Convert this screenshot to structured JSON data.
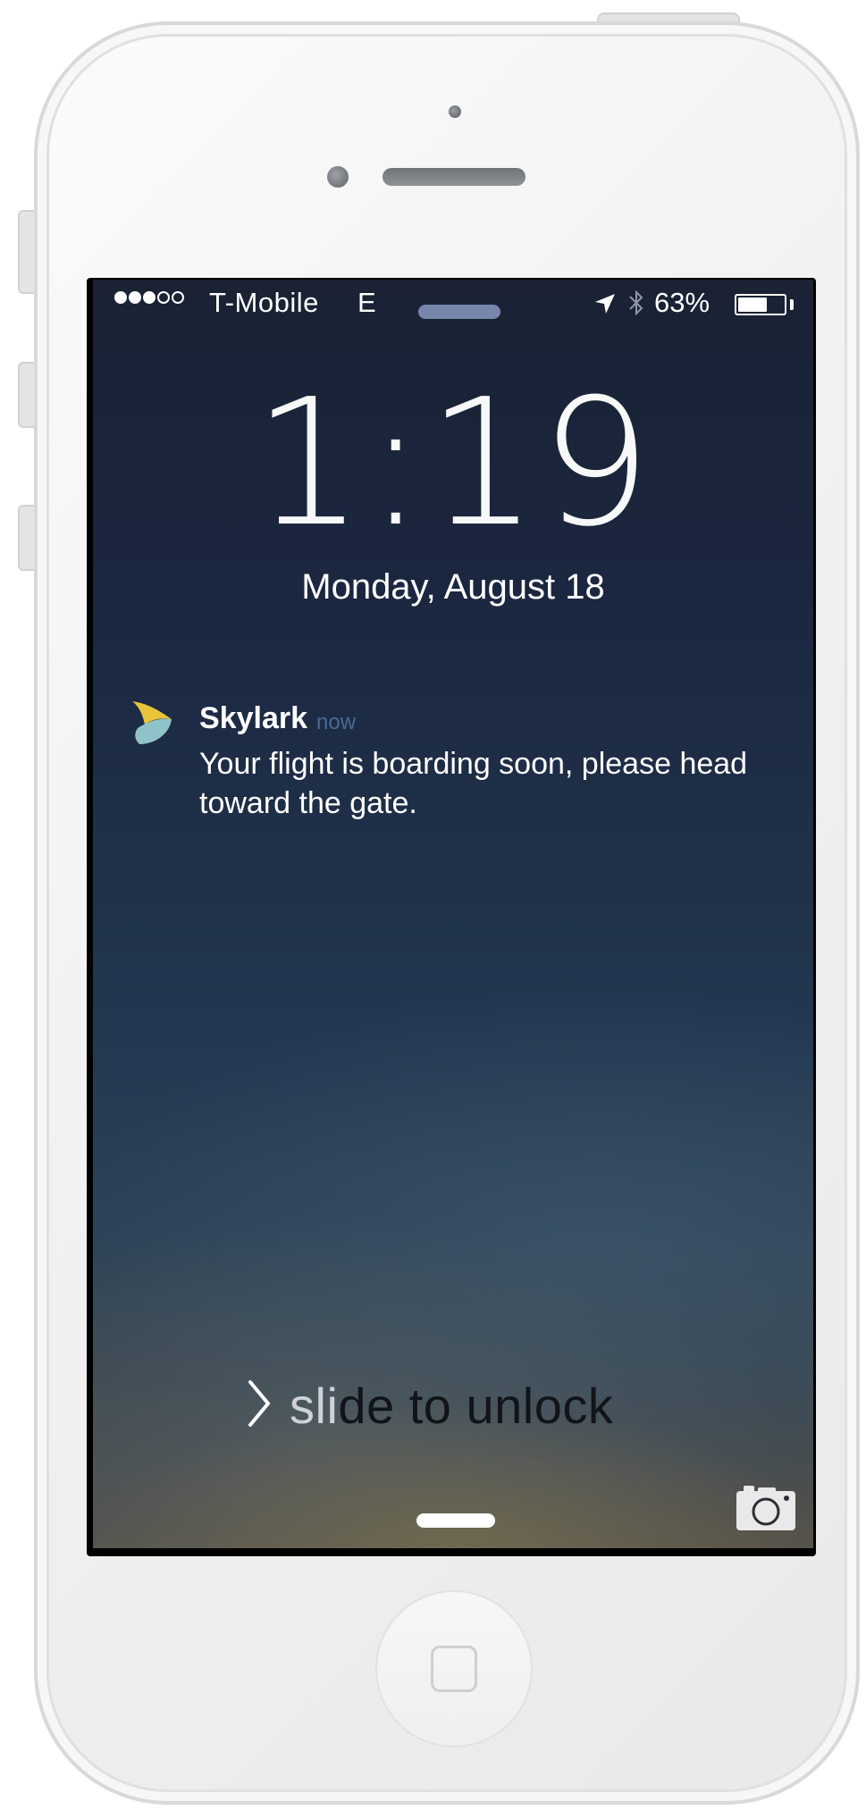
{
  "status_bar": {
    "signal_bars_filled": 3,
    "signal_bars_total": 5,
    "carrier": "T-Mobile",
    "network": "E",
    "battery_percent": "63%",
    "battery_level": 0.63
  },
  "lock_screen": {
    "time": "1:19",
    "date": "Monday, August 18"
  },
  "notification": {
    "app_name": "Skylark",
    "time": "now",
    "message": "Your flight is boarding soon, please head toward the gate."
  },
  "unlock": {
    "label_shine": "sli",
    "label_rest": "de to unlock"
  },
  "icons": {
    "location": "location-arrow-icon",
    "bluetooth": "bluetooth-icon",
    "battery": "battery-icon",
    "camera": "camera-icon",
    "chevron": "chevron-right-icon",
    "app": "skylark-app-icon"
  },
  "colors": {
    "notif_time": "#4a6a92",
    "wallpaper_top": "#1a2234",
    "wallpaper_bottom": "#55524a",
    "skylark_yellow": "#e8c43a",
    "skylark_teal": "#8fc3c9"
  }
}
